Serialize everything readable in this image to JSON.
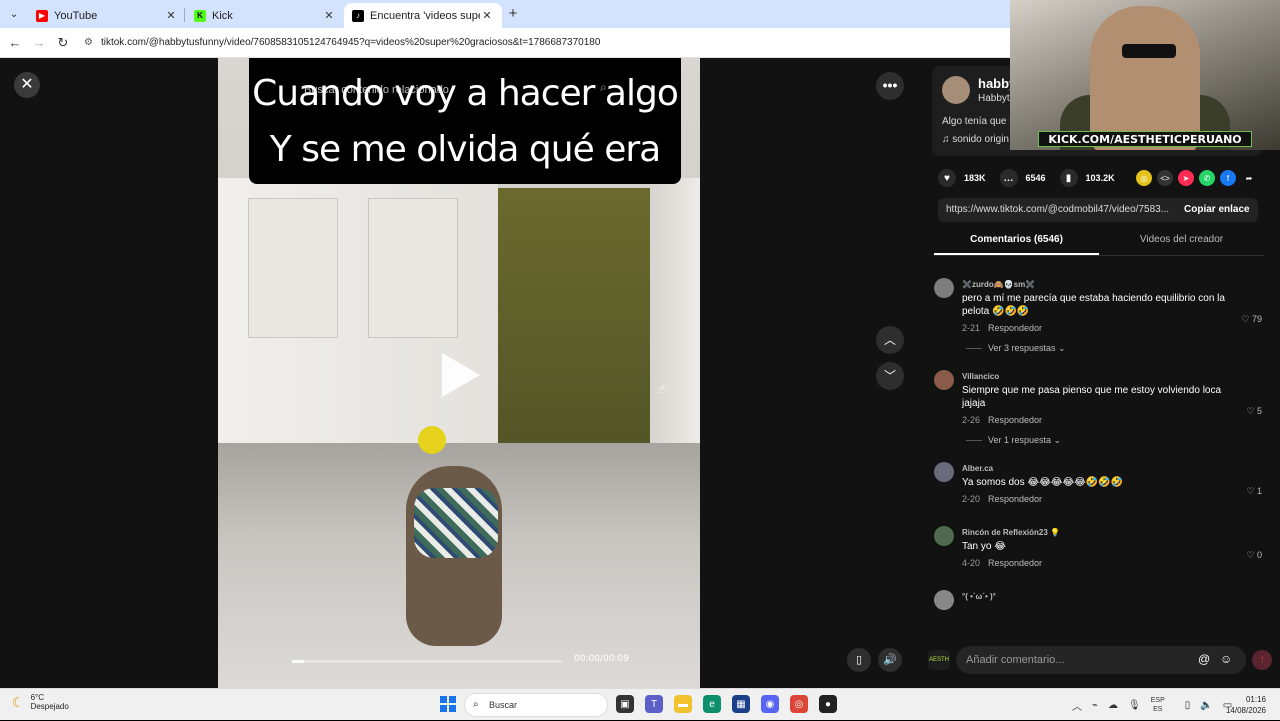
{
  "browser": {
    "tabs": [
      {
        "title": "YouTube",
        "close": "✕",
        "favicon_color": "#ff0000"
      },
      {
        "title": "Kick",
        "close": "✕",
        "favicon_color": "#53fc18"
      },
      {
        "title": "Encuentra 'videos super gracio",
        "close": "✕",
        "favicon_color": "#000000"
      }
    ],
    "new_tab": "+",
    "url": "tiktok.com/@habbytusfunny/video/7608583105124764945?q=videos%20super%20graciosos&t=1786687370180"
  },
  "video": {
    "caption_line1": "Cuando voy a hacer algo",
    "caption_line2": "Y se me olvida qué era",
    "search_placeholder": "Buscar contenido relacionado",
    "time": "00:00/00:09",
    "progress": 0.0
  },
  "creator": {
    "name": "habby",
    "handle": "Habbytu",
    "description": "Algo tenía que h",
    "sound": "♫  sonido origin"
  },
  "actions": {
    "likes": "183K",
    "comments": "6546",
    "saves": "103.2K"
  },
  "share": {
    "link": "https://www.tiktok.com/@codmobil47/video/7583...",
    "copy_label": "Copiar enlace"
  },
  "tabs": {
    "comments": "Comentarios (6546)",
    "videos": "Videos del creador"
  },
  "comments": [
    {
      "user": "✖️zurdo🙈💀sm✖️",
      "text": "pero a mí me parecía que estaba haciendo equilibrio con la pelota 🤣🤣🤣",
      "date": "2-21",
      "reply": "Respondedor",
      "likes": "79",
      "replies": "Ver 3 respuestas ⌄"
    },
    {
      "user": "Villancico",
      "text": "Siempre que me pasa pienso que me estoy volviendo loca jajaja",
      "date": "2-26",
      "reply": "Respondedor",
      "likes": "5",
      "replies": "Ver 1 respuesta ⌄"
    },
    {
      "user": "Alber.ca",
      "text": "Ya somos dos 😂😂😂😂😂🤣🤣🤣",
      "date": "2-20",
      "reply": "Respondedor",
      "likes": "1",
      "replies": ""
    },
    {
      "user": "Rincón de Reflexión23 💡",
      "text": "Tan yo 😂",
      "date": "4-20",
      "reply": "Respondedor",
      "likes": "0",
      "replies": ""
    },
    {
      "user": "°( •`ω´• )°",
      "text": "",
      "date": "",
      "reply": "",
      "likes": "",
      "replies": ""
    }
  ],
  "comment_input": {
    "placeholder": "Añadir comentario...",
    "at": "@",
    "emoji": "☺"
  },
  "webcam": {
    "banner": "KICK.COM/AESTHETICPERUANO"
  },
  "taskbar": {
    "temp": "6°C",
    "weather": "Despejado",
    "search": "Buscar",
    "lang1": "ESP",
    "lang2": "ES",
    "time": "01:16",
    "date": "14/08/2026"
  }
}
